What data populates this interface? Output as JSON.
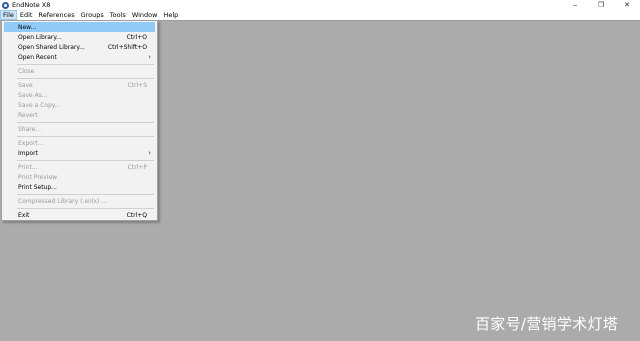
{
  "window": {
    "title": "EndNote X8",
    "controls": {
      "minimize": "‒",
      "restore": "❐",
      "close": "✕"
    }
  },
  "menubar": {
    "items": [
      "File",
      "Edit",
      "References",
      "Groups",
      "Tools",
      "Window",
      "Help"
    ]
  },
  "file_menu": {
    "new": {
      "label": "New...",
      "shortcut": ""
    },
    "open_library": {
      "label": "Open Library...",
      "shortcut": "Ctrl+O"
    },
    "open_shared_library": {
      "label": "Open Shared Library...",
      "shortcut": "Ctrl+Shift+O"
    },
    "open_recent": {
      "label": "Open Recent",
      "arrow": "›"
    },
    "close": {
      "label": "Close"
    },
    "save": {
      "label": "Save",
      "shortcut": "Ctrl+S"
    },
    "save_as": {
      "label": "Save As..."
    },
    "save_copy": {
      "label": "Save a Copy..."
    },
    "revert": {
      "label": "Revert"
    },
    "share": {
      "label": "Share..."
    },
    "export": {
      "label": "Export..."
    },
    "import": {
      "label": "Import",
      "arrow": "›"
    },
    "print": {
      "label": "Print...",
      "shortcut": "Ctrl+P"
    },
    "print_preview": {
      "label": "Print Preview"
    },
    "print_setup": {
      "label": "Print Setup..."
    },
    "compressed_library": {
      "label": "Compressed Library (.enlx) ..."
    },
    "exit": {
      "label": "Exit",
      "shortcut": "Ctrl+Q"
    }
  },
  "watermark": {
    "text": "百家号/营销学术灯塔"
  },
  "colors": {
    "workspace": "#ababab",
    "menu_highlight": "#91c9f7",
    "disabled_text": "#9a9a9a"
  }
}
